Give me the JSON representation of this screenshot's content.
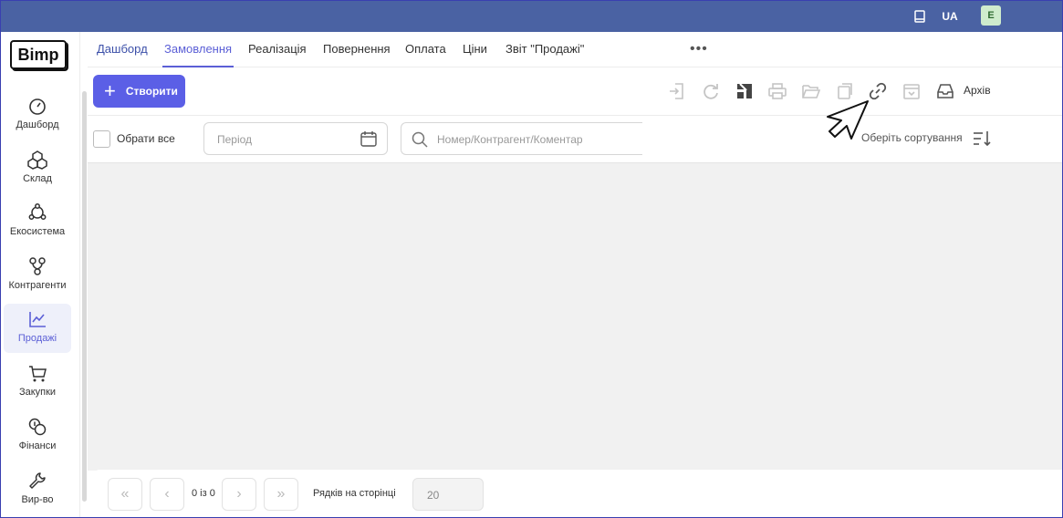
{
  "topbar": {
    "lang": "UA",
    "avatar_letter": "E"
  },
  "logo": "Bimp",
  "sidebar": {
    "items": [
      {
        "label": "Дашборд",
        "icon": "speedometer-icon",
        "active": false
      },
      {
        "label": "Склад",
        "icon": "boxes-icon",
        "active": false
      },
      {
        "label": "Екосистема",
        "icon": "ecosystem-icon",
        "active": false
      },
      {
        "label": "Контрагенти",
        "icon": "network-icon",
        "active": false
      },
      {
        "label": "Продажі",
        "icon": "chart-line-icon",
        "active": true
      },
      {
        "label": "Закупки",
        "icon": "cart-icon",
        "active": false
      },
      {
        "label": "Фінанси",
        "icon": "coins-icon",
        "active": false
      },
      {
        "label": "Вир-во",
        "icon": "wrench-icon",
        "active": false
      }
    ]
  },
  "tabs": [
    {
      "label": "Дашборд"
    },
    {
      "label": "Замовлення"
    },
    {
      "label": "Реалізація"
    },
    {
      "label": "Повернення"
    },
    {
      "label": "Оплата"
    },
    {
      "label": "Ціни"
    },
    {
      "label": "Звіт \"Продажі\""
    }
  ],
  "tabs_more": "•••",
  "toolbar": {
    "create_label": "Створити",
    "archive_label": "Архів"
  },
  "filters": {
    "select_all": "Обрати все",
    "period_placeholder": "Період",
    "search_placeholder": "Номер/Контрагент/Коментар",
    "sort_label": "Оберіть сортування"
  },
  "pager": {
    "count": "0 із 0",
    "rows_label": "Рядків на сторінці",
    "rows_value": "20"
  },
  "colors": {
    "accent": "#5b5fe6",
    "topbar": "#4a62a3"
  }
}
